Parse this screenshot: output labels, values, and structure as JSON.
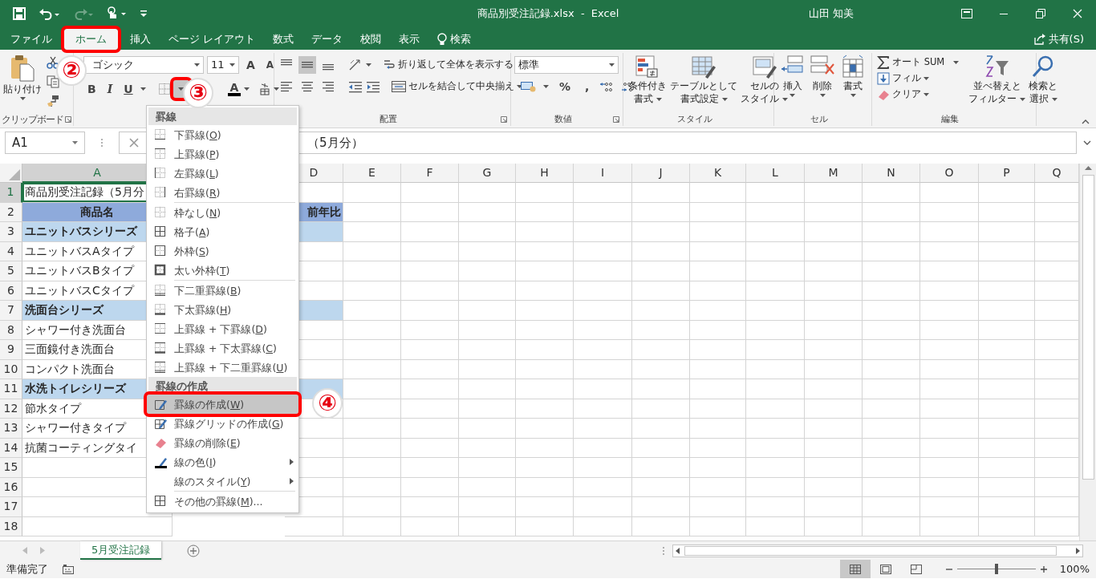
{
  "title_bar": {
    "title": "商品別受注記録.xlsx  -  Excel",
    "user": "山田 知美"
  },
  "ribbon_tabs": [
    {
      "label": "ファイル",
      "selected": false,
      "highlighted": false
    },
    {
      "label": "ホーム",
      "selected": true,
      "highlighted": true
    },
    {
      "label": "挿入",
      "selected": false,
      "highlighted": false
    },
    {
      "label": "ページ レイアウト",
      "selected": false,
      "highlighted": false
    },
    {
      "label": "数式",
      "selected": false,
      "highlighted": false
    },
    {
      "label": "データ",
      "selected": false,
      "highlighted": false
    },
    {
      "label": "校閲",
      "selected": false,
      "highlighted": false
    },
    {
      "label": "表示",
      "selected": false,
      "highlighted": false
    }
  ],
  "tell_me": {
    "label": "検索"
  },
  "share": {
    "label": "共有(S)"
  },
  "clipboard": {
    "paste": "貼り付け",
    "group_label": "クリップボード"
  },
  "font": {
    "name": "ゴシック",
    "size": "11",
    "grow": "A",
    "shrink": "A",
    "bold": "B",
    "italic": "I",
    "underline": "U",
    "border_dropdown_highlighted": true,
    "color_letter": "A"
  },
  "alignment": {
    "vertical_align_buttons": [
      {
        "selected": false
      },
      {
        "selected": true
      },
      {
        "selected": false
      }
    ],
    "wrap": "折り返して全体を表示する",
    "merge": "セルを結合して中央揃え",
    "group_label": "配置"
  },
  "number": {
    "format": "標準",
    "percent": "%",
    "comma": ",",
    "group_label": "数値"
  },
  "styles": {
    "buttons": [
      {
        "lines": [
          "条件付き",
          "書式"
        ]
      },
      {
        "lines": [
          "テーブルとして",
          "書式設定"
        ]
      },
      {
        "lines": [
          "セルの",
          "スタイル"
        ]
      }
    ],
    "group_label": "スタイル"
  },
  "cells": {
    "buttons": [
      {
        "label": "挿入"
      },
      {
        "label": "削除"
      },
      {
        "label": "書式"
      }
    ],
    "group_label": "セル"
  },
  "editing": {
    "autosum": "オート SUM",
    "fill": "フィル",
    "clear": "クリア",
    "sort": [
      "並べ替えと",
      "フィルター"
    ],
    "find": [
      "検索と",
      "選択"
    ],
    "group_label": "編集"
  },
  "formula_bar": {
    "name_box": "A1",
    "formula": "（5月分）"
  },
  "sheet": {
    "columns": [
      {
        "label": "A",
        "selected": true
      },
      {
        "label": "D",
        "selected": false
      },
      {
        "label": "E",
        "selected": false
      },
      {
        "label": "F",
        "selected": false
      },
      {
        "label": "G",
        "selected": false
      },
      {
        "label": "H",
        "selected": false
      },
      {
        "label": "I",
        "selected": false
      },
      {
        "label": "J",
        "selected": false
      },
      {
        "label": "K",
        "selected": false
      },
      {
        "label": "L",
        "selected": false
      },
      {
        "label": "M",
        "selected": false
      },
      {
        "label": "N",
        "selected": false
      },
      {
        "label": "O",
        "selected": false
      },
      {
        "label": "P",
        "selected": false
      },
      {
        "label": "Q",
        "selected": false
      }
    ],
    "rows": [
      {
        "number": "1",
        "kind": "title",
        "selected": true,
        "a": "商品別受注記録（5月分"
      },
      {
        "number": "2",
        "kind": "header",
        "selected": false,
        "a": "商品名",
        "d": "前年比"
      },
      {
        "number": "3",
        "kind": "group",
        "selected": false,
        "a": "ユニットバスシリーズ"
      },
      {
        "number": "4",
        "kind": "item",
        "selected": false,
        "a": "ユニットバスAタイプ"
      },
      {
        "number": "5",
        "kind": "item",
        "selected": false,
        "a": "ユニットバスBタイプ"
      },
      {
        "number": "6",
        "kind": "item",
        "selected": false,
        "a": "ユニットバスCタイプ"
      },
      {
        "number": "7",
        "kind": "group",
        "selected": false,
        "a": "洗面台シリーズ"
      },
      {
        "number": "8",
        "kind": "item",
        "selected": false,
        "a": "シャワー付き洗面台"
      },
      {
        "number": "9",
        "kind": "item",
        "selected": false,
        "a": "三面鏡付き洗面台"
      },
      {
        "number": "10",
        "kind": "item",
        "selected": false,
        "a": "コンパクト洗面台"
      },
      {
        "number": "11",
        "kind": "group",
        "selected": false,
        "a": "水洗トイレシリーズ"
      },
      {
        "number": "12",
        "kind": "item",
        "selected": false,
        "a": "節水タイプ"
      },
      {
        "number": "13",
        "kind": "item",
        "selected": false,
        "a": "シャワー付きタイプ"
      },
      {
        "number": "14",
        "kind": "item",
        "selected": false,
        "a": "抗菌コーティングタイ"
      },
      {
        "number": "15",
        "kind": "item",
        "selected": false
      },
      {
        "number": "16",
        "kind": "item",
        "selected": false
      },
      {
        "number": "17",
        "kind": "item",
        "selected": false
      },
      {
        "number": "18",
        "kind": "item",
        "selected": false
      }
    ]
  },
  "border_menu": {
    "sections": [
      {
        "title": "罫線",
        "groups": [
          [
            {
              "label": "下罫線(O)",
              "kind": "bottom",
              "selected": false,
              "submenu": false
            },
            {
              "label": "上罫線(P)",
              "kind": "top",
              "selected": false,
              "submenu": false
            },
            {
              "label": "左罫線(L)",
              "kind": "left",
              "selected": false,
              "submenu": false
            },
            {
              "label": "右罫線(R)",
              "kind": "right",
              "selected": false,
              "submenu": false
            }
          ],
          [
            {
              "label": "枠なし(N)",
              "kind": "none",
              "selected": false,
              "submenu": false
            },
            {
              "label": "格子(A)",
              "kind": "all",
              "selected": false,
              "submenu": false
            },
            {
              "label": "外枠(S)",
              "kind": "outside",
              "selected": false,
              "submenu": false
            },
            {
              "label": "太い外枠(T)",
              "kind": "thick-outside",
              "selected": false,
              "submenu": false
            }
          ],
          [
            {
              "label": "下二重罫線(B)",
              "kind": "double-bottom",
              "selected": false,
              "submenu": false
            },
            {
              "label": "下太罫線(H)",
              "kind": "thick-bottom",
              "selected": false,
              "submenu": false
            },
            {
              "label": "上罫線 + 下罫線(D)",
              "kind": "top-bottom",
              "selected": false,
              "submenu": false
            },
            {
              "label": "上罫線 + 下太罫線(C)",
              "kind": "top-thick-bottom",
              "selected": false,
              "submenu": false
            },
            {
              "label": "上罫線 + 下二重罫線(U)",
              "kind": "top-double-bottom",
              "selected": false,
              "submenu": false
            }
          ]
        ]
      },
      {
        "title": "罫線の作成",
        "groups": [
          [
            {
              "label": "罫線の作成(W)",
              "kind": "draw",
              "selected": true,
              "submenu": false
            },
            {
              "label": "罫線グリッドの作成(G)",
              "kind": "draw-grid",
              "selected": false,
              "submenu": false
            },
            {
              "label": "罫線の削除(E)",
              "kind": "erase",
              "selected": false,
              "submenu": false
            },
            {
              "label": "線の色(I)",
              "kind": "line-color",
              "selected": false,
              "submenu": true
            },
            {
              "label": "線のスタイル(Y)",
              "kind": "line-style",
              "selected": false,
              "submenu": true
            }
          ],
          [
            {
              "label": "その他の罫線(M)...",
              "kind": "all",
              "selected": false,
              "submenu": false
            }
          ]
        ]
      }
    ]
  },
  "annotations": [
    {
      "label": "②"
    },
    {
      "label": "③"
    },
    {
      "label": "④"
    }
  ],
  "sheet_tabs": [
    {
      "label": "5月受注記録",
      "selected": true
    }
  ],
  "status_bar": {
    "ready": "準備完了",
    "views": [
      {
        "selected": true
      },
      {
        "selected": false
      },
      {
        "selected": false
      }
    ],
    "zoom_slider": {
      "level": 0.5
    },
    "zoom": "100%"
  }
}
